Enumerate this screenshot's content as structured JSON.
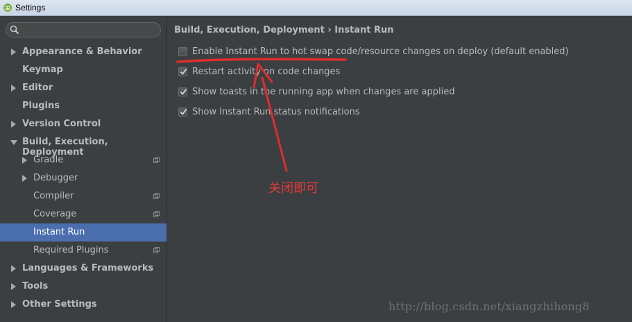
{
  "window": {
    "title": "Settings"
  },
  "search": {
    "placeholder": ""
  },
  "sidebar": {
    "items": [
      {
        "label": "Appearance & Behavior",
        "arrow": "right",
        "bold": true
      },
      {
        "label": "Keymap",
        "arrow": "",
        "bold": true
      },
      {
        "label": "Editor",
        "arrow": "right",
        "bold": true
      },
      {
        "label": "Plugins",
        "arrow": "",
        "bold": true
      },
      {
        "label": "Version Control",
        "arrow": "right",
        "bold": true
      },
      {
        "label": "Build, Execution, Deployment",
        "arrow": "down",
        "bold": true
      },
      {
        "label": "Gradle",
        "arrow": "right",
        "bold": false
      },
      {
        "label": "Debugger",
        "arrow": "right",
        "bold": false
      },
      {
        "label": "Compiler",
        "arrow": "",
        "bold": false
      },
      {
        "label": "Coverage",
        "arrow": "",
        "bold": false
      },
      {
        "label": "Instant Run",
        "arrow": "",
        "bold": false,
        "selected": true
      },
      {
        "label": "Required Plugins",
        "arrow": "",
        "bold": false
      },
      {
        "label": "Languages & Frameworks",
        "arrow": "right",
        "bold": true
      },
      {
        "label": "Tools",
        "arrow": "right",
        "bold": true
      },
      {
        "label": "Other Settings",
        "arrow": "right",
        "bold": true
      }
    ]
  },
  "main": {
    "breadcrumb": "Build, Execution, Deployment › Instant Run",
    "options": [
      {
        "label": "Enable Instant Run to hot swap code/resource changes on deploy (default enabled)",
        "checked": false
      },
      {
        "label": "Restart activity on code changes",
        "checked": true
      },
      {
        "label": "Show toasts in the running app when changes are applied",
        "checked": true
      },
      {
        "label": "Show Instant Run status notifications",
        "checked": true
      }
    ]
  },
  "annotation": {
    "text": "关闭即可",
    "color": "#e33a3a"
  },
  "watermark": {
    "text": "http://blog.csdn.net/xiangzhihong8"
  }
}
